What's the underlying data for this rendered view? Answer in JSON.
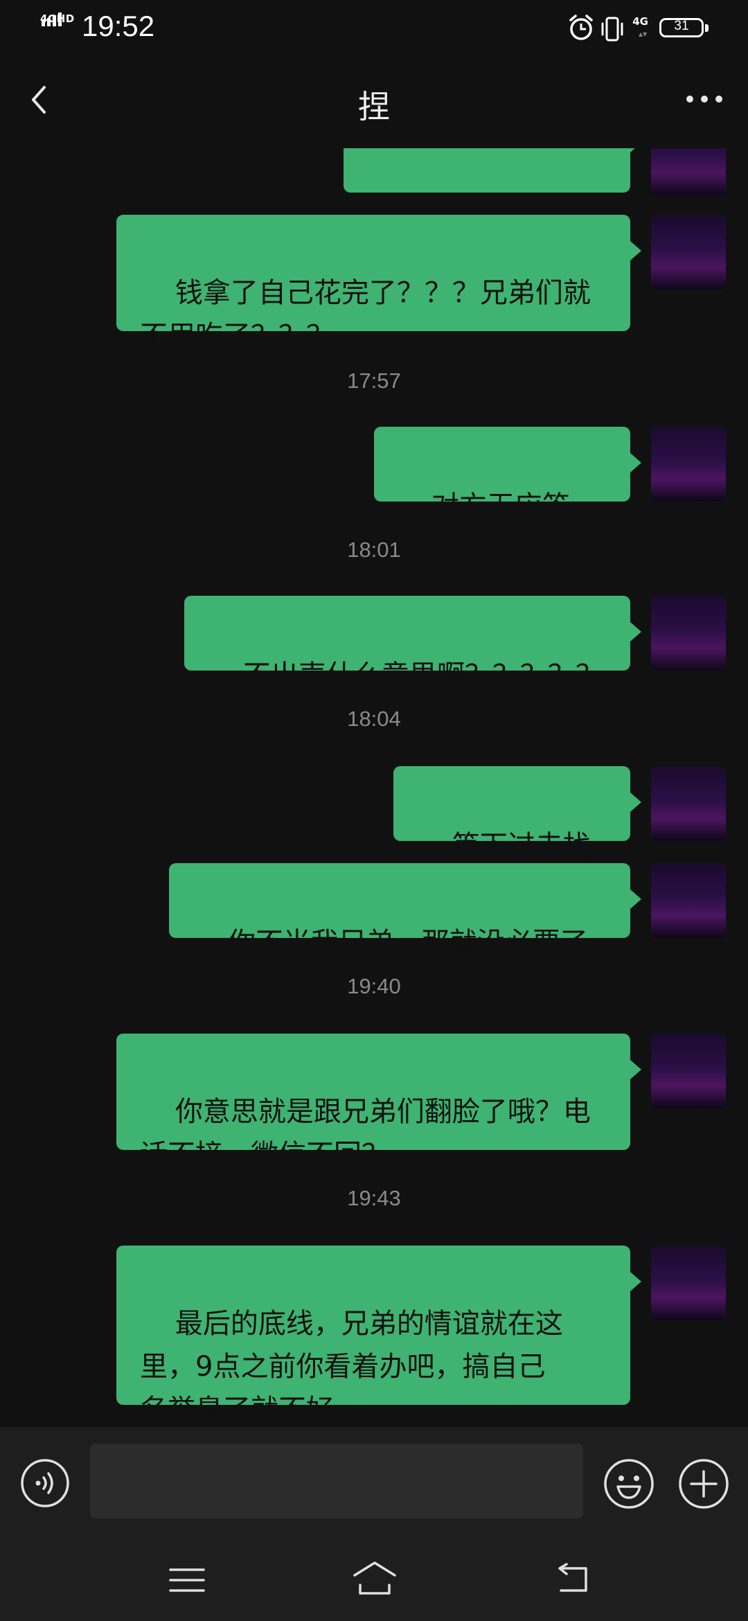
{
  "status_bar": {
    "network_label": "4GHD",
    "time": "19:52",
    "cellular_label": "4G",
    "battery_level": "31",
    "icons": [
      "signal-icon",
      "alarm-icon",
      "vibrate-icon",
      "battery-icon"
    ]
  },
  "header": {
    "title": "捏",
    "back_icon": "chevron-left-icon",
    "more_icon": "more-dots-icon"
  },
  "messages": [
    {
      "type": "sent",
      "text": "？？？？？？？？",
      "partial": true
    },
    {
      "type": "sent",
      "text": "钱拿了自己花完了？？？兄弟们就\n不用吃了？？？"
    },
    {
      "type": "time",
      "text": "17:57"
    },
    {
      "type": "sent",
      "text": "对方无应答",
      "icon": "hang-up-icon"
    },
    {
      "type": "time",
      "text": "18:01"
    },
    {
      "type": "sent",
      "text": "不出声什么意思啊？？？？？"
    },
    {
      "type": "time",
      "text": "18:04"
    },
    {
      "type": "sent",
      "text": "等下过去找你"
    },
    {
      "type": "sent",
      "text": "你不当我兄弟，那就没必要了"
    },
    {
      "type": "time",
      "text": "19:40"
    },
    {
      "type": "sent",
      "text": "你意思就是跟兄弟们翻脸了哦？电\n话不接，微信不回？"
    },
    {
      "type": "time",
      "text": "19:43"
    },
    {
      "type": "sent",
      "text": "最后的底线，兄弟的情谊就在这\n里，9点之前你看着办吧，搞自己\n名誉臭了就不好"
    }
  ],
  "input_bar": {
    "placeholder": "",
    "value": "",
    "icons": [
      "voice-icon",
      "emoji-icon",
      "plus-icon"
    ]
  },
  "nav_bar": {
    "icons": [
      "menu-icon",
      "home-icon",
      "back-icon"
    ]
  },
  "colors": {
    "background": "#111111",
    "bubble_sent": "#3fb371",
    "bar_background": "#1e1e1e",
    "timestamp_text": "#8a8a8a"
  }
}
